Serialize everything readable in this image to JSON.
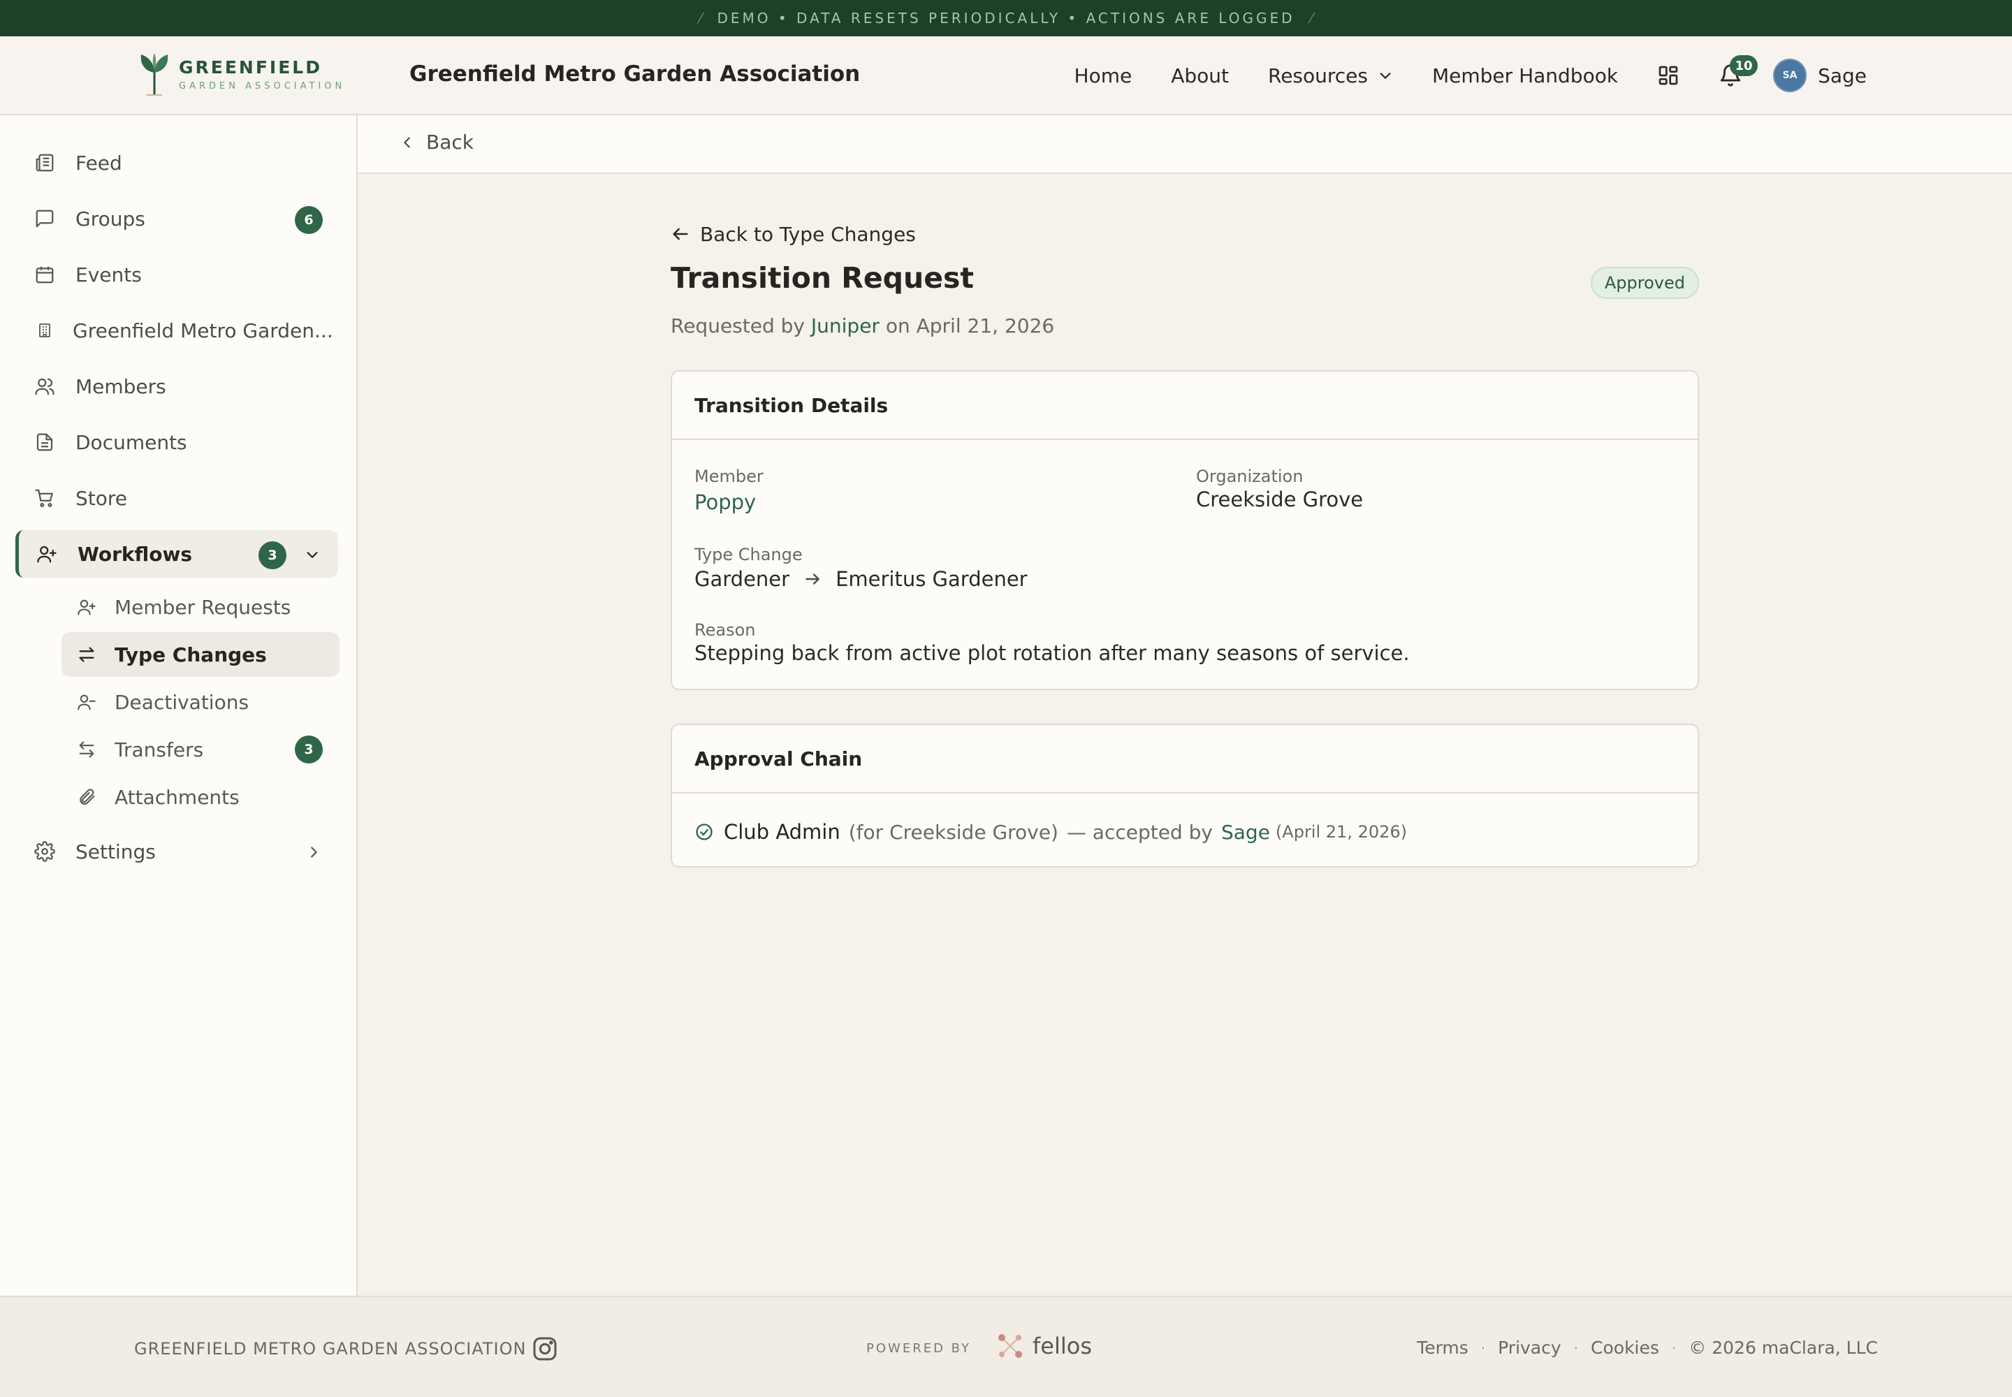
{
  "banner": {
    "text": "DEMO • DATA RESETS PERIODICALLY • ACTIONS ARE LOGGED",
    "left_mark": "⁄",
    "right_mark": "⁄"
  },
  "header": {
    "logo_line1": "GREENFIELD",
    "logo_line2": "GARDEN ASSOCIATION",
    "org_title": "Greenfield Metro Garden Association",
    "nav": [
      {
        "label": "Home"
      },
      {
        "label": "About"
      },
      {
        "label": "Resources"
      },
      {
        "label": "Member Handbook"
      }
    ],
    "notification_count": "10",
    "user": {
      "initials": "SA",
      "name": "Sage"
    }
  },
  "sidebar": {
    "items": [
      {
        "label": "Feed",
        "icon": "newspaper-icon"
      },
      {
        "label": "Groups",
        "icon": "chat-icon",
        "badge": "6"
      },
      {
        "label": "Events",
        "icon": "calendar-icon"
      },
      {
        "label": "Greenfield Metro Garden...",
        "icon": "building-icon"
      },
      {
        "label": "Members",
        "icon": "users-icon"
      },
      {
        "label": "Documents",
        "icon": "document-icon"
      },
      {
        "label": "Store",
        "icon": "cart-icon"
      },
      {
        "label": "Workflows",
        "icon": "user-plus-icon",
        "badge": "3"
      },
      {
        "label": "Settings",
        "icon": "gear-icon"
      }
    ],
    "workflow_sub": [
      {
        "label": "Member Requests",
        "icon": "user-plus-icon"
      },
      {
        "label": "Type Changes",
        "icon": "swap-icon",
        "active": true
      },
      {
        "label": "Deactivations",
        "icon": "user-minus-icon"
      },
      {
        "label": "Transfers",
        "icon": "transfer-icon",
        "badge": "3"
      },
      {
        "label": "Attachments",
        "icon": "paperclip-icon"
      }
    ]
  },
  "backbar": {
    "label": "Back"
  },
  "page": {
    "back_link": "Back to Type Changes",
    "title": "Transition Request",
    "status": "Approved",
    "requested_prefix": "Requested by",
    "requested_by": "Juniper",
    "requested_on": "on April 21, 2026"
  },
  "details": {
    "title": "Transition Details",
    "member_label": "Member",
    "member_value": "Poppy",
    "org_label": "Organization",
    "org_value": "Creekside Grove",
    "type_change_label": "Type Change",
    "from_type": "Gardener",
    "to_type": "Emeritus Gardener",
    "reason_label": "Reason",
    "reason_value": "Stepping back from active plot rotation after many seasons of service."
  },
  "approval": {
    "title": "Approval Chain",
    "role": "Club Admin",
    "scope": "(for Creekside Grove)",
    "accepted_text": "— accepted by",
    "accepted_by": "Sage",
    "date": "(April 21, 2026)"
  },
  "footer": {
    "org": "GREENFIELD METRO GARDEN ASSOCIATION",
    "powered_by": "POWERED BY",
    "brand": "fellos",
    "links": [
      "Terms",
      "Privacy",
      "Cookies"
    ],
    "copyright": "© 2026 maClara, LLC",
    "separator": "·"
  },
  "colors": {
    "brand_green": "#2f6648",
    "banner_bg": "#1c4128",
    "page_bg": "#f5f1eb",
    "approved_bg": "#e4efe4"
  }
}
